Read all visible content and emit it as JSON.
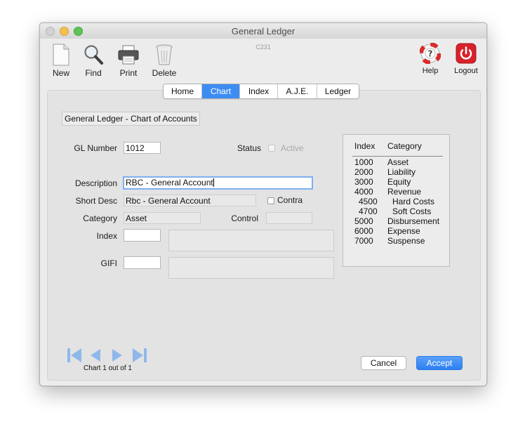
{
  "window": {
    "title": "General Ledger",
    "code": "C231"
  },
  "toolbar": {
    "new_label": "New",
    "find_label": "Find",
    "print_label": "Print",
    "delete_label": "Delete",
    "help_label": "Help",
    "logout_label": "Logout"
  },
  "tabs": [
    {
      "label": "Home",
      "active": false
    },
    {
      "label": "Chart",
      "active": true
    },
    {
      "label": "Index",
      "active": false
    },
    {
      "label": "A.J.E.",
      "active": false
    },
    {
      "label": "Ledger",
      "active": false
    }
  ],
  "form": {
    "section_title": "General Ledger - Chart of Accounts",
    "gl_number_label": "GL Number",
    "gl_number_value": "1012",
    "status_label": "Status",
    "active_label": "Active",
    "active_checked": false,
    "description_label": "Description",
    "description_value": "RBC - General Account",
    "short_desc_label": "Short Desc",
    "short_desc_value": "Rbc - General Account",
    "contra_label": "Contra",
    "contra_checked": false,
    "category_label": "Category",
    "category_value": "Asset",
    "control_label": "Control",
    "control_value": "",
    "index_label": "Index",
    "index_value": "",
    "gifi_label": "GIFI",
    "gifi_value": ""
  },
  "index_table": {
    "headers": [
      "Index",
      "Category"
    ],
    "rows": [
      {
        "index": "1000",
        "category": "Asset",
        "sub": false
      },
      {
        "index": "2000",
        "category": "Liability",
        "sub": false
      },
      {
        "index": "3000",
        "category": "Equity",
        "sub": false
      },
      {
        "index": "4000",
        "category": "Revenue",
        "sub": false
      },
      {
        "index": "4500",
        "category": "Hard Costs",
        "sub": true
      },
      {
        "index": "4700",
        "category": "Soft Costs",
        "sub": true
      },
      {
        "index": "5000",
        "category": "Disbursement",
        "sub": false
      },
      {
        "index": "6000",
        "category": "Expense",
        "sub": false
      },
      {
        "index": "7000",
        "category": "Suspense",
        "sub": false
      }
    ]
  },
  "navigation": {
    "caption": "Chart 1 out of 1"
  },
  "buttons": {
    "cancel_label": "Cancel",
    "accept_label": "Accept"
  },
  "colors": {
    "accent": "#3d8cf3",
    "logout_red": "#d8222a",
    "nav_icon": "#8fb8ea"
  }
}
